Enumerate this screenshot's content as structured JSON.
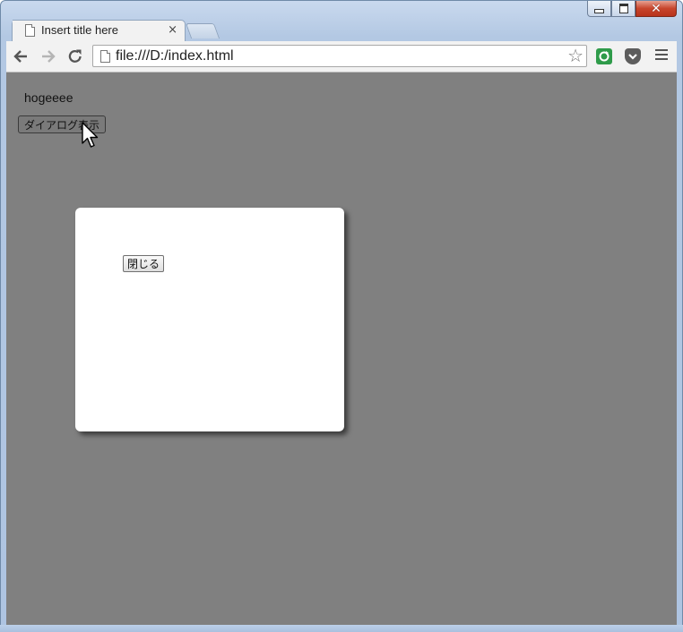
{
  "browser": {
    "tab_title": "Insert title here",
    "tab_close": "×",
    "url": "file:///D:/index.html",
    "star": "☆",
    "caption": {
      "close": "✕"
    }
  },
  "page": {
    "text": "hogeeee",
    "open_dialog_label": "ダイアログ表示"
  },
  "dialog": {
    "close_label": "閉じる"
  },
  "colors": {
    "overlay": "#808080",
    "dialog_bg": "#ffffff"
  }
}
